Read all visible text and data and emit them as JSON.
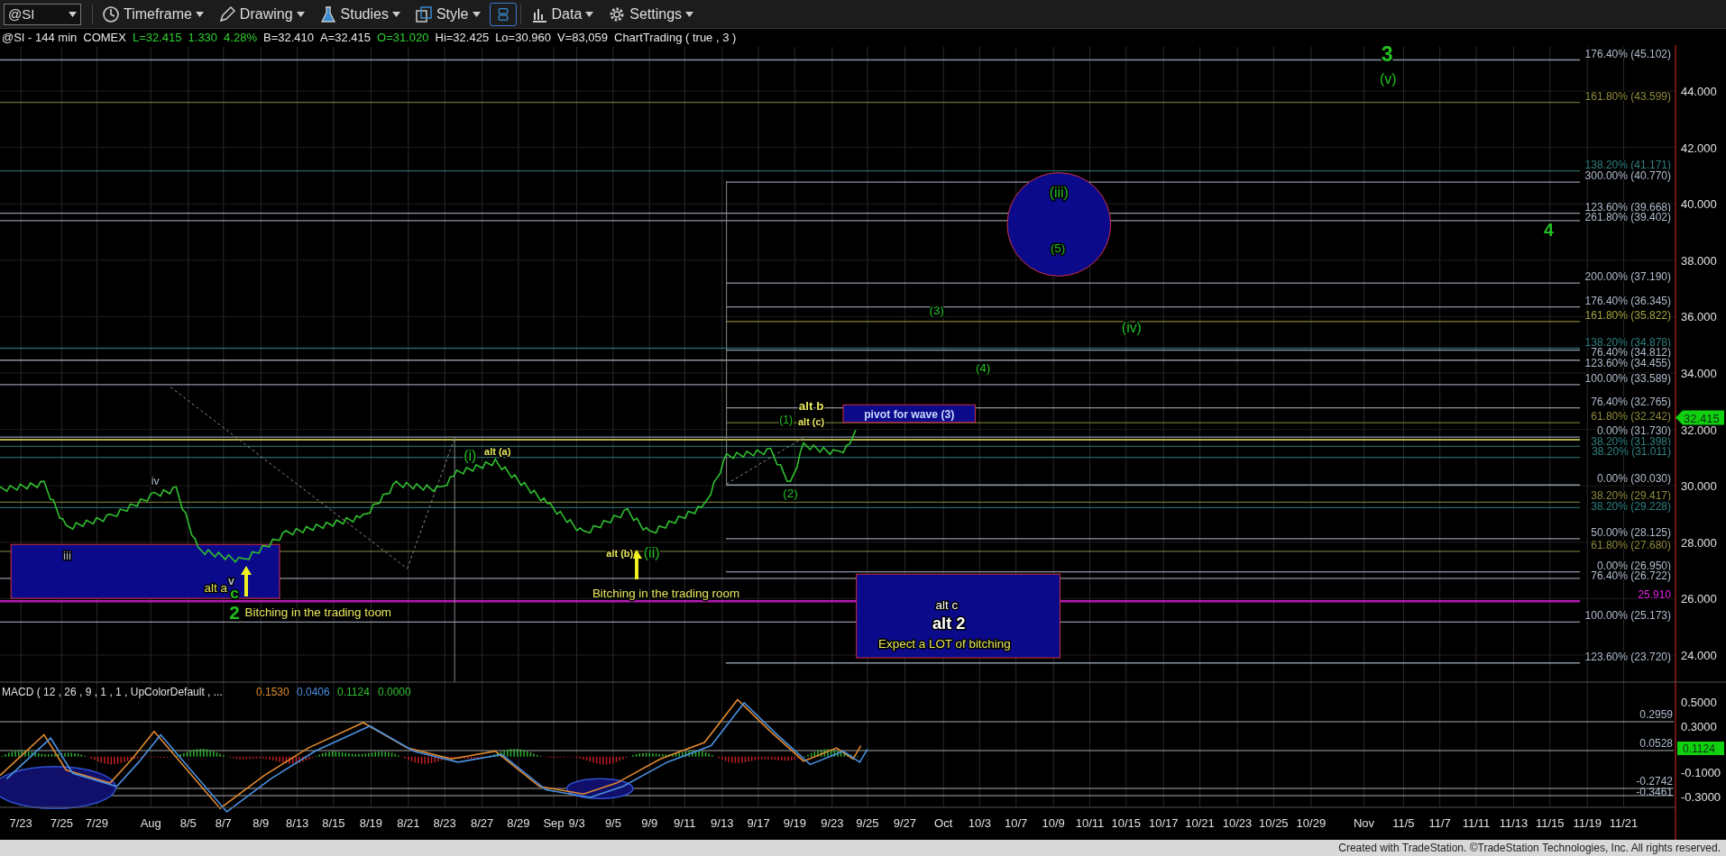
{
  "toolbar": {
    "symbol": "@SI",
    "items": [
      {
        "kind": "menu",
        "label": "Timeframe"
      },
      {
        "kind": "menu",
        "label": "Drawing"
      },
      {
        "kind": "menu",
        "label": "Studies"
      },
      {
        "kind": "menu",
        "label": "Style"
      },
      {
        "kind": "panel"
      },
      {
        "kind": "menu",
        "label": "Data"
      },
      {
        "kind": "menu",
        "label": "Settings"
      }
    ]
  },
  "info_line": [
    {
      "text": "@SI - 144 min",
      "kind": "plain"
    },
    {
      "text": "COMEX",
      "kind": "plain"
    },
    {
      "text": "L=32.415",
      "kind": "up"
    },
    {
      "text": "1.330",
      "kind": "up"
    },
    {
      "text": "4.28%",
      "kind": "up"
    },
    {
      "text": "B=32.410",
      "kind": "plain"
    },
    {
      "text": "A=32.415",
      "kind": "plain"
    },
    {
      "text": "O=31.020",
      "kind": "up"
    },
    {
      "text": "Hi=32.425",
      "kind": "plain"
    },
    {
      "text": "Lo=30.960",
      "kind": "plain"
    },
    {
      "text": "V=83,059",
      "kind": "plain"
    },
    {
      "text": "ChartTrading ( true , 3 )",
      "kind": "plain"
    }
  ],
  "price_axis": {
    "ticks": [
      "44.000",
      "42.000",
      "40.000",
      "38.000",
      "36.000",
      "34.000",
      "32.000",
      "30.000",
      "28.000",
      "26.000",
      "24.000"
    ],
    "last_price": "32.415"
  },
  "fib_levels": [
    {
      "label": "176.40% (45.102)",
      "color": "#b0bccc"
    },
    {
      "label": "161.80% (43.599)",
      "color": "#8c8a3c"
    },
    {
      "label": "138.20% (41.171)",
      "color": "#2f8080"
    },
    {
      "label": "300.00% (40.770)",
      "color": "#b0bccc"
    },
    {
      "label": "123.60% (39.668)",
      "color": "#b0bccc"
    },
    {
      "label": "261.80% (39.402)",
      "color": "#b0bccc"
    },
    {
      "label": "200.00% (37.190)",
      "color": "#b0bccc"
    },
    {
      "label": "176.40% (36.345)",
      "color": "#b0bccc"
    },
    {
      "label": "161.80% (35.822)",
      "color": "#a6a43e"
    },
    {
      "label": "138.20% (34.878)",
      "color": "#2f8080"
    },
    {
      "label": "76.40% (34.812)",
      "color": "#b0bccc"
    },
    {
      "label": "123.60% (34.455)",
      "color": "#b0bccc"
    },
    {
      "label": "100.00% (33.589)",
      "color": "#b0bccc"
    },
    {
      "label": "76.40% (32.765)",
      "color": "#b0bccc"
    },
    {
      "label": "61.80% (32.242)",
      "color": "#8c8a3c"
    },
    {
      "label": "0.00% (31.730)",
      "color": "#b0bccc"
    },
    {
      "label": "38.20% (31.398)",
      "color": "#2f8080"
    },
    {
      "label": "38.20% (31.011)",
      "color": "#2f8080"
    },
    {
      "label": "0.00% (30.030)",
      "color": "#b0bccc"
    },
    {
      "label": "38.20% (29.417)",
      "color": "#8c8a3c"
    },
    {
      "label": "38.20% (29.228)",
      "color": "#2f8080"
    },
    {
      "label": "50.00% (28.125)",
      "color": "#b0bccc"
    },
    {
      "label": "61.80% (27.680)",
      "color": "#8c8a3c"
    },
    {
      "label": "0.00% (26.950)",
      "color": "#b0bccc"
    },
    {
      "label": "76.40% (26.722)",
      "color": "#b0bccc"
    },
    {
      "label": "25.910",
      "color": "#e020e0"
    },
    {
      "label": "100.00% (25.173)",
      "color": "#b0bccc"
    },
    {
      "label": "123.60% (23.720)",
      "color": "#b0bccc"
    }
  ],
  "annotations": [
    {
      "text": "3",
      "color": "#22c022"
    },
    {
      "text": "(v)",
      "color": "#22c022"
    },
    {
      "text": "(iii)",
      "color": "#22c022"
    },
    {
      "text": "(5)",
      "color": "#22c022"
    },
    {
      "text": "4",
      "color": "#22c022"
    },
    {
      "text": "(3)",
      "color": "#22c022"
    },
    {
      "text": "(iv)",
      "color": "#22c022"
    },
    {
      "text": "(4)",
      "color": "#22c022"
    },
    {
      "text": "alt b",
      "color": "#e8e860"
    },
    {
      "text": "(1)",
      "color": "#22c022"
    },
    {
      "text": "alt (c)",
      "color": "#e8e860"
    },
    {
      "text": "pivot for wave (3)",
      "color": "#c8d8ff"
    },
    {
      "text": "(i)",
      "color": "#22c022"
    },
    {
      "text": "alt (a)",
      "color": "#e8e860"
    },
    {
      "text": "iv",
      "color": "#b0bccc"
    },
    {
      "text": "(2)",
      "color": "#22c022"
    },
    {
      "text": "iii",
      "color": "#b0bccc"
    },
    {
      "text": "alt (b)",
      "color": "#e8e860"
    },
    {
      "text": "(ii)",
      "color": "#22c022"
    },
    {
      "text": "v",
      "color": "#b0bccc"
    },
    {
      "text": "alt a",
      "color": "#e8e860"
    },
    {
      "text": "c",
      "color": "#22c022"
    },
    {
      "text": "Bitching in the trading room",
      "color": "#e8e860"
    },
    {
      "text": "2",
      "color": "#22c022"
    },
    {
      "text": "Bitching in the trading toom",
      "color": "#e8e860"
    },
    {
      "text": "alt c",
      "color": "#ffffff"
    },
    {
      "text": "alt 2",
      "color": "#ffffff"
    },
    {
      "text": "Expect a LOT of bitching",
      "color": "#e8e860"
    }
  ],
  "macd": {
    "title": "MACD ( 12 , 26 , 9 , 1 , 1 , UpColorDefault , ...",
    "values": [
      {
        "text": "0.1530",
        "color": "#e08a30"
      },
      {
        "text": "0.0406",
        "color": "#4a90e0"
      },
      {
        "text": "0.1124",
        "color": "#30c030"
      },
      {
        "text": "0.0000",
        "color": "#30c030"
      }
    ],
    "ticks": [
      "0.5000",
      "0.3000",
      "-0.1000",
      "-0.3000"
    ],
    "levels": [
      "0.2959",
      "0.0528",
      "-0.2742",
      "-0.3461"
    ],
    "last_value": "0.1124"
  },
  "date_axis": [
    "7/23",
    "7/25",
    "7/29",
    "Aug",
    "8/5",
    "8/7",
    "8/9",
    "8/13",
    "8/15",
    "8/19",
    "8/21",
    "8/23",
    "8/27",
    "8/29",
    "Sep",
    "9/3",
    "9/5",
    "9/9",
    "9/11",
    "9/13",
    "9/17",
    "9/19",
    "9/23",
    "9/25",
    "9/27",
    "Oct",
    "10/3",
    "10/7",
    "10/9",
    "10/11",
    "10/15",
    "10/17",
    "10/21",
    "10/23",
    "10/25",
    "10/29",
    "Nov",
    "11/5",
    "11/7",
    "11/11",
    "11/13",
    "11/15",
    "11/19",
    "11/21"
  ],
  "footer": "Created with TradeStation. ©TradeStation Technologies, Inc. All rights reserved."
}
